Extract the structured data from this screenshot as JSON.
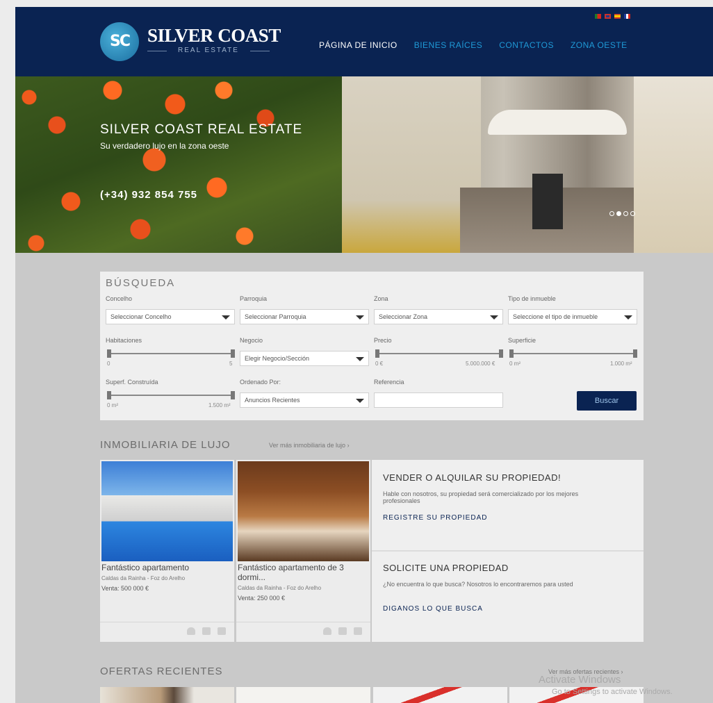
{
  "header": {
    "logo_initials": "SC",
    "logo_title": "SILVER COAST",
    "logo_subtitle": "REAL ESTATE",
    "nav": [
      "PÁGINA DE INICIO",
      "BIENES RAÍCES",
      "CONTACTOS",
      "ZONA OESTE"
    ],
    "flags": [
      "portugal-flag",
      "uk-flag",
      "spain-flag",
      "france-flag"
    ]
  },
  "hero": {
    "title": "SILVER COAST REAL ESTATE",
    "subtitle": "Su verdadero lujo en la zona oeste",
    "phone": "(+34) 932 854 755",
    "slides": 4,
    "active_slide": 2
  },
  "search": {
    "title": "BÚSQUEDA",
    "concelho_label": "Concelho",
    "concelho_value": "Seleccionar Concelho",
    "parroquia_label": "Parroquia",
    "parroquia_value": "Seleccionar Parroquia",
    "zona_label": "Zona",
    "zona_value": "Seleccionar Zona",
    "tipo_label": "Tipo de inmueble",
    "tipo_value": "Seleccione el tipo de inmueble",
    "habitaciones_label": "Habitaciones",
    "habitaciones_min": "0",
    "habitaciones_max": "5",
    "negocio_label": "Negocio",
    "negocio_value": "Elegir Negocio/Sección",
    "precio_label": "Precio",
    "precio_min": "0 €",
    "precio_max": "5.000.000 €",
    "superficie_label": "Superficie",
    "superficie_min": "0 m²",
    "superficie_max": "1.000 m²",
    "superf_construida_label": "Superf. Construída",
    "superf_construida_min": "0 m²",
    "superf_construida_max": "1.500 m²",
    "ordenado_label": "Ordenado Por:",
    "ordenado_value": "Anuncios Recientes",
    "referencia_label": "Referencia",
    "button": "Buscar"
  },
  "luxury": {
    "title": "INMOBILIARIA DE LUJO",
    "link": "Ver más inmobiliaria de lujo",
    "cards": [
      {
        "title": "Fantástico apartamento",
        "location": "Caldas da Rainha - Foz do Arelho",
        "price": "Venta: 500 000 €"
      },
      {
        "title": "Fantástico apartamento de 3 dormi...",
        "location": "Caldas da Rainha - Foz do Arelho",
        "price": "Venta: 250 000 €"
      }
    ]
  },
  "promo": {
    "sell_title": "VENDER O ALQUILAR SU PROPIEDAD!",
    "sell_text": "Hable con nosotros, su propiedad será comercializado por los mejores profesionales",
    "sell_link": "REGISTRE SU PROPIEDAD",
    "request_title": "SOLICITE UNA PROPIEDAD",
    "request_text": "¿No encuentra lo que busca? Nosotros lo encontraremos para usted",
    "request_link": "DIGANOS LO QUE BUSCA"
  },
  "recent": {
    "title": "OFERTAS RECIENTES",
    "link": "Ver más ofertas recientes"
  },
  "watermark": {
    "line1": "Activate Windows",
    "line2": "Go to Settings to activate Windows."
  },
  "colors": {
    "header_bg": "#0a2352",
    "nav_link": "#1f9ad7",
    "page_bg": "#c9c9c9"
  }
}
